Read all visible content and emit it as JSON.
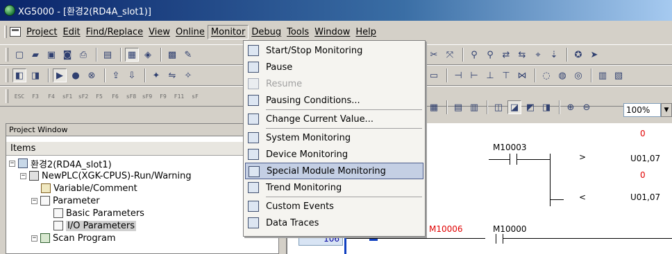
{
  "window": {
    "title": "XG5000 - [환경2(RD4A_slot1)]"
  },
  "menubar": {
    "items": [
      "Project",
      "Edit",
      "Find/Replace",
      "View",
      "Online",
      "Monitor",
      "Debug",
      "Tools",
      "Window",
      "Help"
    ],
    "active": "Monitor"
  },
  "toolbar": {
    "fkeys": [
      "ESC",
      "F3",
      "F4",
      "sF1",
      "sF2",
      "F5",
      "F6",
      "sF8",
      "sF9",
      "F9",
      "F11",
      "sF"
    ],
    "zoom": "100%"
  },
  "monitor_menu": {
    "items": [
      {
        "label": "Start/Stop Monitoring",
        "icon": "monitor-icon"
      },
      {
        "label": "Pause",
        "icon": "pause-icon"
      },
      {
        "label": "Resume",
        "icon": "resume-icon",
        "disabled": true
      },
      {
        "label": "Pausing Conditions...",
        "icon": "conditions-icon"
      },
      {
        "label": "Change Current Value...",
        "icon": "change-value-icon"
      },
      {
        "label": "System Monitoring",
        "icon": "system-icon"
      },
      {
        "label": "Device Monitoring",
        "icon": "device-icon"
      },
      {
        "label": "Special Module Monitoring",
        "icon": "module-icon",
        "highlighted": true
      },
      {
        "label": "Trend Monitoring",
        "icon": "trend-icon"
      },
      {
        "label": "Custom Events",
        "icon": "events-icon"
      },
      {
        "label": "Data Traces",
        "icon": "trace-icon"
      }
    ]
  },
  "project_window": {
    "title": "Project Window",
    "header": "Items",
    "tree": [
      {
        "label": "환경2(RD4A_slot1)",
        "level": 0
      },
      {
        "label": "NewPLC(XGK-CPUS)-Run/Warning",
        "level": 1
      },
      {
        "label": "Variable/Comment",
        "level": 2
      },
      {
        "label": "Parameter",
        "level": 2
      },
      {
        "label": "Basic Parameters",
        "level": 3
      },
      {
        "label": "I/O Parameters",
        "level": 3,
        "selected": true
      },
      {
        "label": "Scan Program",
        "level": 2
      }
    ]
  },
  "ladder": {
    "rung_number": "106",
    "contacts": [
      "M10003",
      "M10006",
      "M10000"
    ],
    "values": [
      "0",
      "0"
    ],
    "operators": [
      ">",
      "<"
    ],
    "addresses": [
      "U01,07",
      "U01,07"
    ]
  }
}
